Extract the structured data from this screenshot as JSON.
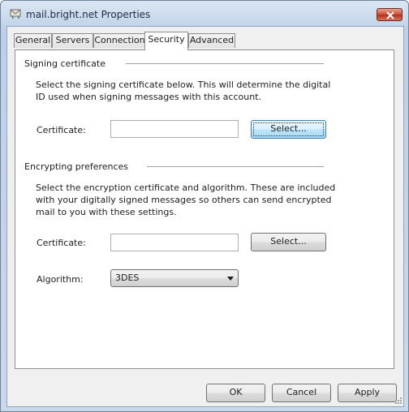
{
  "window": {
    "title": "mail.bright.net Properties",
    "icons": {
      "app": "mailbox-icon",
      "close": "close-icon"
    }
  },
  "tabs": [
    {
      "label": "General"
    },
    {
      "label": "Servers"
    },
    {
      "label": "Connection"
    },
    {
      "label": "Security",
      "selected": true
    },
    {
      "label": "Advanced"
    }
  ],
  "signing": {
    "heading": "Signing certificate",
    "description_line1": "Select the signing certificate below. This will determine the digital",
    "description_line2": "ID used when signing messages with this account.",
    "certificate_label": "Certificate:",
    "certificate_value": "",
    "select_button": "Select..."
  },
  "encrypting": {
    "heading": "Encrypting preferences",
    "description_line1": "Select the encryption certificate and algorithm. These are included",
    "description_line2": "with your digitally signed messages so others can send encrypted",
    "description_line3": "mail to you with these settings.",
    "certificate_label": "Certificate:",
    "certificate_value": "",
    "select_button": "Select...",
    "algorithm_label": "Algorithm:",
    "algorithm_value": "3DES",
    "dropdown_icon": "chevron-down-icon"
  },
  "buttons": {
    "ok": "OK",
    "cancel": "Cancel",
    "apply": "Apply"
  },
  "colors": {
    "title_bar": "#c4d5ea",
    "close_button": "#c94d35",
    "focused_button": "#3c7fb1"
  }
}
